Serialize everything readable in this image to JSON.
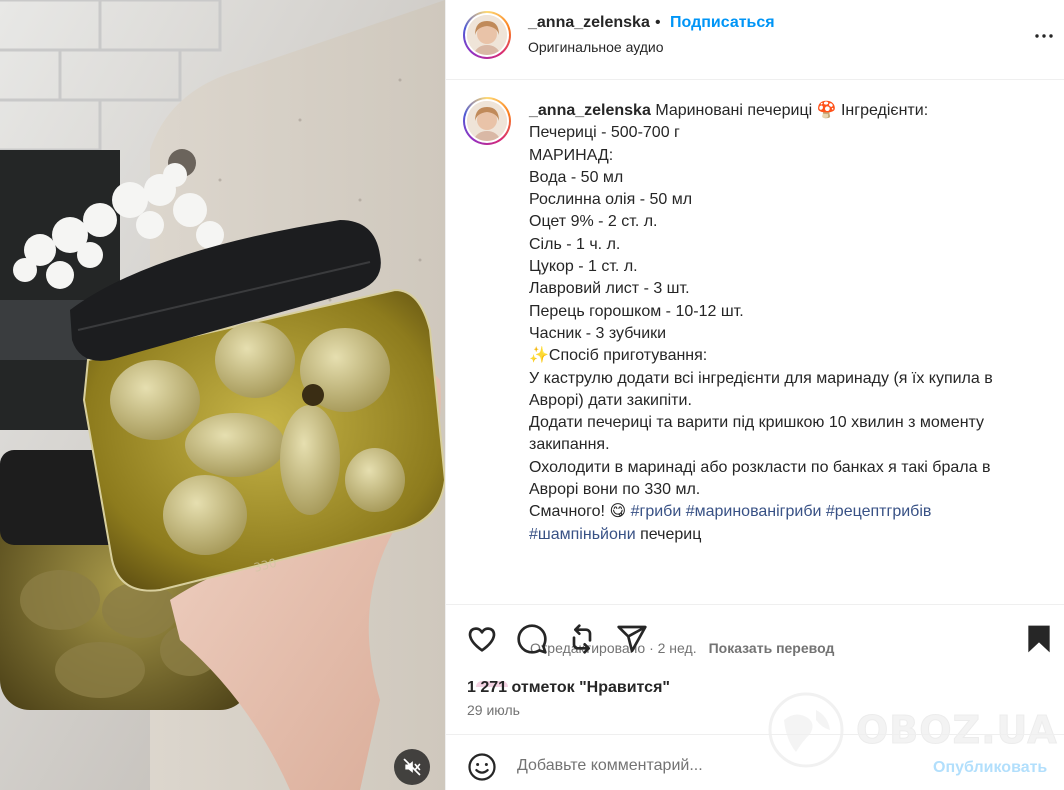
{
  "post": {
    "username": "_anna_zelenska",
    "separator": "•",
    "follow_label": "Подписаться",
    "audio_label": "Оригинальное аудио"
  },
  "caption": {
    "username": "_anna_zelenska",
    "lines": [
      "Мариновані печериці 🍄 Інгредієнти:",
      "Печериці - 500-700 г",
      "МАРИНАД:",
      "Вода - 50 мл",
      "Рослинна олія - 50 мл",
      "Оцет 9% - 2 ст. л.",
      "Сіль - 1 ч. л.",
      "Цукор - 1 ст. л.",
      "Лавровий лист - 3 шт.",
      "Перець горошком - 10-12 шт.",
      "Часник - 3 зубчики",
      "✨Спосіб приготування:",
      "У каструлю додати всі інгредієнти для маринаду (я їх купила в",
      "Аврорі) дати закипіти.",
      "Додати печериці та варити під кришкою 10 хвилин з моменту",
      "закипання.",
      "Охолодити в маринаді або розкласти по банках я такі брала в",
      "Аврорі вони по 330 мл.",
      "Смачного! 😋"
    ],
    "hashtags": [
      "#гриби",
      "#маринованігриби",
      "#рецептгрибів",
      "#шампіньйони"
    ],
    "trailing_word": "печериц"
  },
  "meta": {
    "edited": "Отредактировано · 2 нед.",
    "translate_label": "Показать перевод"
  },
  "actions": {
    "likes": "1 271 отметок \"Нравится\"",
    "date": "29 июль"
  },
  "comment": {
    "placeholder": "Добавьте комментарий...",
    "post_label": "Опубликовать"
  },
  "watermark": {
    "text": "OBOZ.UA"
  },
  "colors": {
    "accent": "#0095f6",
    "hashtag": "#385185",
    "muted": "#737373",
    "post_disabled": "#b2dffc"
  }
}
